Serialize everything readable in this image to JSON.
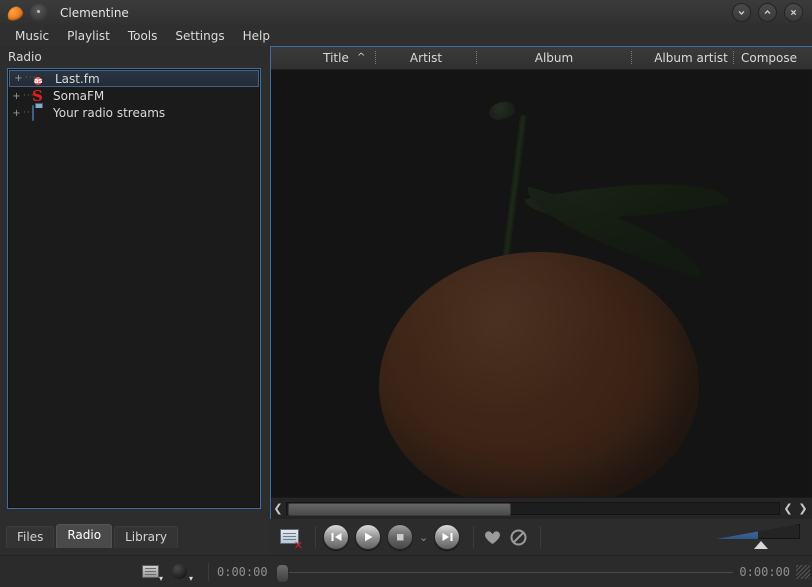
{
  "window": {
    "title": "Clementine",
    "app_icon": "clementine-icon",
    "doc_icon": "document-icon",
    "buttons": [
      {
        "name": "minimize-button",
        "icon": "chevron-down-icon"
      },
      {
        "name": "maximize-button",
        "icon": "chevron-up-icon"
      },
      {
        "name": "close-button",
        "icon": "close-icon"
      }
    ]
  },
  "menubar": {
    "items": [
      {
        "label": "Music"
      },
      {
        "label": "Playlist"
      },
      {
        "label": "Tools"
      },
      {
        "label": "Settings"
      },
      {
        "label": "Help"
      }
    ]
  },
  "sidebar": {
    "panel_title": "Radio",
    "tree": [
      {
        "label": "Last.fm",
        "expander": "+",
        "icon": "lastfm-icon",
        "icon_text": "as",
        "selected": true
      },
      {
        "label": "SomaFM",
        "expander": "+",
        "icon": "somafm-icon",
        "icon_text": "S",
        "selected": false
      },
      {
        "label": "Your radio streams",
        "expander": "+",
        "icon": "radio-streams-icon",
        "icon_text": "",
        "selected": false
      }
    ],
    "tabs": [
      {
        "label": "Files",
        "active": false
      },
      {
        "label": "Radio",
        "active": true
      },
      {
        "label": "Library",
        "active": false
      }
    ]
  },
  "playlist": {
    "columns": [
      {
        "label": "Title",
        "sorted": true,
        "sort_icon": "sort-ascending-icon"
      },
      {
        "label": "Artist",
        "sorted": false
      },
      {
        "label": "Album",
        "sorted": false
      },
      {
        "label": "Album artist",
        "sorted": false
      },
      {
        "label": "Compose",
        "sorted": false
      }
    ],
    "rows": [],
    "watermark": "clementine-watermark",
    "scrollbar": {
      "left_arrow": "chevron-left-icon",
      "right_arrow_pair": [
        "chevron-left-icon",
        "chevron-right-icon"
      ]
    }
  },
  "transport": {
    "clear_playlist": {
      "name": "clear-playlist-button",
      "icon": "playlist-clear-icon"
    },
    "previous": {
      "name": "previous-track-button",
      "icon": "previous-icon"
    },
    "play": {
      "name": "play-button",
      "icon": "play-icon"
    },
    "stop": {
      "name": "stop-button",
      "icon": "stop-icon"
    },
    "stop_menu": {
      "name": "stop-options-button",
      "icon": "chevron-down-icon"
    },
    "next": {
      "name": "next-track-button",
      "icon": "next-icon"
    },
    "love": {
      "name": "love-button",
      "icon": "heart-icon"
    },
    "ban": {
      "name": "ban-button",
      "icon": "ban-icon"
    },
    "volume": {
      "name": "volume-slider",
      "level": 50
    }
  },
  "statusbar": {
    "playlist_mode": {
      "name": "repeat-mode-button",
      "icon": "repeat-icon"
    },
    "shuffle_mode": {
      "name": "shuffle-mode-button",
      "icon": "shuffle-icon"
    },
    "time_elapsed": "0:00:00",
    "time_total": "0:00:00",
    "track_position": 0,
    "resize_grip": "resize-grip-icon"
  },
  "colors": {
    "accent": "#3c6fa4",
    "window_bg": "#2d2d2d",
    "panel_bg": "#1b1b1b",
    "playlist_bg": "#141414",
    "text": "#d9d9d9",
    "lastfm_red": "#e23b3b",
    "somafm_red": "#e02020",
    "volume_blue": "#3f6a9d"
  }
}
